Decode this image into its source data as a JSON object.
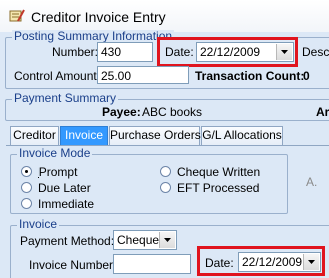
{
  "window": {
    "title": "Creditor Invoice Entry",
    "icon": "notebook-pen-icon"
  },
  "posting_summary": {
    "title": "Posting Summary Information",
    "number_label": "Number:",
    "number_value": "430",
    "date_label": "Date:",
    "date_value": "22/12/2009",
    "description_label": "Descrip",
    "control_amount_label": "Control Amount:",
    "control_amount_value": "25.00",
    "transaction_count_label": "Transaction Count:",
    "transaction_count_value": "0"
  },
  "payment_summary": {
    "title": "Payment Summary",
    "payee_label": "Payee:",
    "payee_value": "ABC books",
    "right_label": "Ar"
  },
  "tabs": [
    {
      "label": "Creditor",
      "active": false
    },
    {
      "label": "Invoice",
      "active": true
    },
    {
      "label": "Purchase Orders",
      "active": false
    },
    {
      "label": "G/L Allocations",
      "active": false
    }
  ],
  "invoice_mode": {
    "title": "Invoice Mode",
    "options": [
      {
        "label": "Prompt",
        "selected": true
      },
      {
        "label": "Due Later",
        "selected": false
      },
      {
        "label": "Immediate",
        "selected": false
      },
      {
        "label": "Cheque Written",
        "selected": false
      },
      {
        "label": "EFT Processed",
        "selected": false
      }
    ],
    "right_fragment": "A."
  },
  "invoice": {
    "title": "Invoice",
    "payment_method_label": "Payment Method:",
    "payment_method_value": "Cheque",
    "invoice_number_label": "Invoice Number:",
    "invoice_number_value": "",
    "date_label": "Date:",
    "date_value": "22/12/2009"
  },
  "colors": {
    "highlight_box": "#e0141e",
    "active_tab": "#3399ff",
    "group_title": "#1a3f8a"
  }
}
